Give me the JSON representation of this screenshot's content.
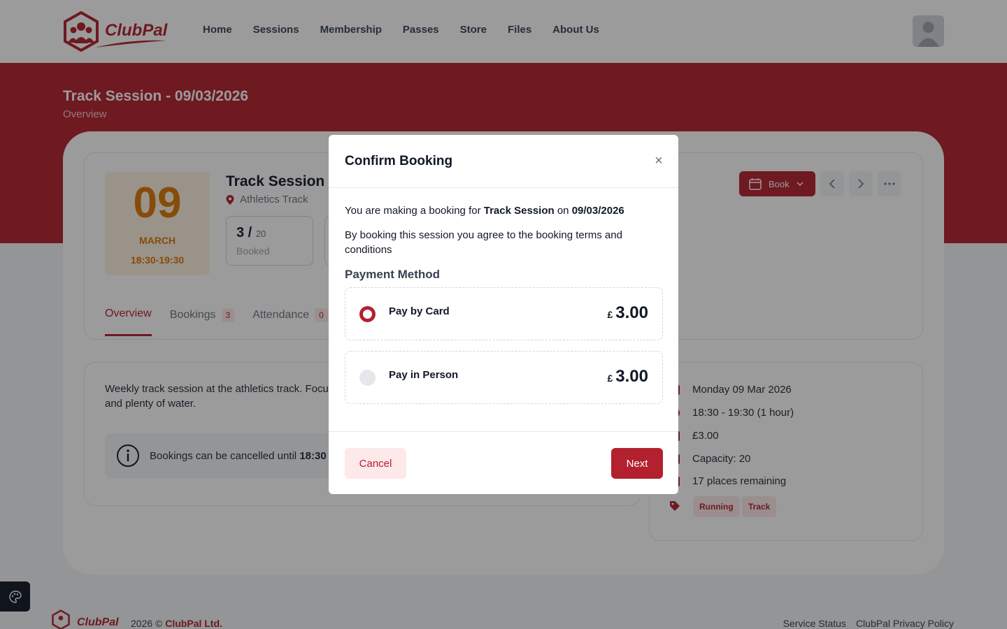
{
  "header": {
    "brand": "ClubPal",
    "nav": [
      "Home",
      "Sessions",
      "Membership",
      "Passes",
      "Store",
      "Files",
      "About Us"
    ]
  },
  "hero": {
    "title": "Track Session - 09/03/2026",
    "subtitle": "Overview"
  },
  "session": {
    "day": "09",
    "month": "MARCH",
    "time": "18:30-19:30",
    "name": "Track Session",
    "location": "Athletics Track",
    "booked_count": "3 /",
    "booked_total": "20",
    "booked_label": "Booked",
    "book_button": "Book"
  },
  "tabs": [
    {
      "label": "Overview",
      "badge": ""
    },
    {
      "label": "Bookings",
      "badge": "3"
    },
    {
      "label": "Attendance",
      "badge": "0"
    }
  ],
  "description": {
    "text": "Weekly track session at the athletics track. Focus and plenty of water.",
    "notice_prefix": "Bookings can be cancelled until",
    "notice_time": "18:30"
  },
  "info": {
    "date": "Monday 09 Mar 2026",
    "time": "18:30 - 19:30 (1 hour)",
    "price": "£3.00",
    "capacity": "Capacity: 20",
    "remaining": "17 places remaining",
    "tags": [
      "Running",
      "Track"
    ]
  },
  "footer": {
    "brand": "ClubPal",
    "copy_prefix": "2026 ©",
    "copy_company": "ClubPal Ltd.",
    "links": [
      "Service Status",
      "ClubPal Privacy Policy"
    ]
  },
  "modal": {
    "title": "Confirm Booking",
    "close": "×",
    "text_prefix": "You are making a booking for",
    "session_name": "Track Session",
    "text_mid": "on",
    "session_date": "09/03/2026",
    "terms": "By booking this session you agree to the booking terms and conditions",
    "payment_label": "Payment Method",
    "options": [
      {
        "name": "Pay by Card",
        "currency": "£",
        "price": "3.00",
        "selected": true
      },
      {
        "name": "Pay in Person",
        "currency": "£",
        "price": "3.00",
        "selected": false
      }
    ],
    "cancel": "Cancel",
    "next": "Next"
  },
  "colors": {
    "brand": "#b3202e",
    "date_accent": "#d97706"
  }
}
